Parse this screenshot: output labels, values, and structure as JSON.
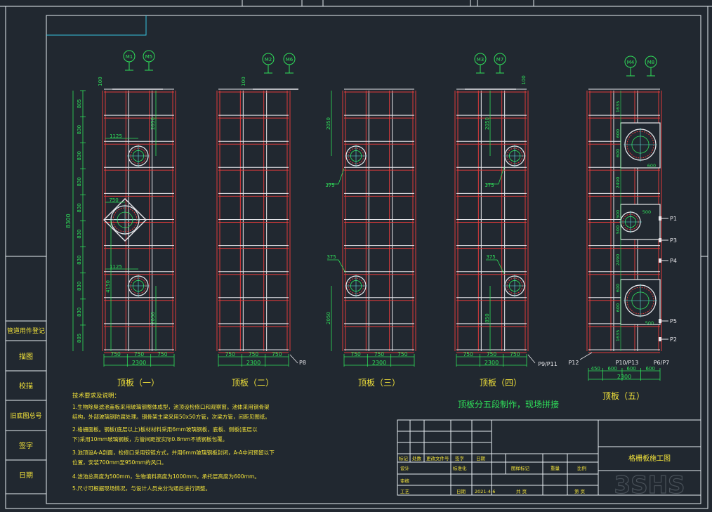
{
  "colors": {
    "background": "#212830",
    "frame": "#e8eef2",
    "border_accent": "#38c5e0",
    "member_red": "#e03a3a",
    "member_white": "#e8e8ec",
    "dimension_green": "#2fe05a",
    "text_yellow": "#f2e23a",
    "marker_cyan": "#5fe6e0"
  },
  "panels": [
    {
      "title": "顶板（一）",
      "tags": [
        "M1",
        "M5"
      ],
      "width_total": "2300",
      "width_parts": [
        "750",
        "750",
        "750"
      ],
      "height_total": "8300",
      "row_dims": [
        "805",
        "830",
        "830",
        "830",
        "830",
        "830",
        "830",
        "830",
        "830",
        "805"
      ],
      "side_dims": [
        "2050",
        "4150",
        "2050"
      ],
      "offsets": [
        "1125",
        "750",
        "1125"
      ],
      "top_dim": "100"
    },
    {
      "title": "顶板（二）",
      "tags": [
        "M2",
        "M6"
      ],
      "width_total": "2300",
      "width_parts": [
        "750",
        "750",
        "750"
      ],
      "top_dim": "100",
      "label": "P8"
    },
    {
      "title": "顶板（三）",
      "tags": [],
      "width_total": "2300",
      "width_parts": [
        "750",
        "750",
        "750"
      ],
      "side_dims": [
        "2050",
        "2050"
      ],
      "leaders": [
        "375",
        "375"
      ]
    },
    {
      "title": "顶板（四）",
      "tags": [
        "M3",
        "M7"
      ],
      "width_total": "2300",
      "width_parts": [
        "750",
        "750",
        "750"
      ],
      "side_dims": [
        "2050",
        "850"
      ],
      "leaders": [
        "375",
        "375"
      ],
      "top_dim": "100",
      "label": "P9/P11"
    },
    {
      "title": "顶板（五）",
      "tags": [
        "M4",
        "M8"
      ],
      "width_total": "2300",
      "width_parts": [
        "450",
        "600",
        "600",
        "600"
      ],
      "side_dims": [
        "1635",
        "600",
        "600",
        "2490",
        "500",
        "500",
        "2490",
        "600",
        "600",
        "1635"
      ],
      "inner_dims": [
        "600",
        "500",
        "500"
      ],
      "ports": [
        "P1",
        "P3",
        "P4",
        "P5",
        "P2"
      ],
      "bottom_labels": [
        "P12",
        "P10/P13",
        "P6/P7"
      ]
    }
  ],
  "segment_note": "顶板分五段制作，现场拼接",
  "notes_title": "技术要求及说明：",
  "notes": [
    "1.生物除臭滤池盖板采用玻璃钢整体成型，池顶设检修口和观察窗。池体采用钢骨架",
    "  结构，外部玻璃钢防腐处理。钢骨架主梁采用50x50方管，次梁方管，间距见图纸。",
    "2.格栅面板。钢板(底层以上)板材材料采用6mm玻璃钢板，底板、侧板(底层以",
    "  下)采用10mm玻璃钢板，方管间距按实际0.8mm不锈钢板包覆。",
    "3.池顶设A-A剖面，检修口采用铰链方式，并用6mm玻璃钢板封闭，A-A中间预留以下",
    "  位置，安装700mm至950mm的风口。",
    "4.滤池总高度为500mm，生物填料高度为1000mm，承托层高度为600mm。",
    "5.尺寸可根据现场情况，与设计人员充分沟通后进行调整。"
  ],
  "left_stamp": [
    "管道用件登记",
    "描图",
    "校描",
    "旧底图总号",
    "签字",
    "日期"
  ],
  "title_block": {
    "drawing_name": "格栅板施工图",
    "rows": [
      [
        "标记",
        "处数",
        "更改文件号",
        "签字",
        "日期"
      ],
      [
        "设计",
        "标准化",
        "图样标记",
        "重量",
        "比例"
      ],
      [
        "审核"
      ],
      [
        "工艺",
        "日期",
        "2021-4-6",
        "共  页",
        "第  页"
      ]
    ]
  },
  "watermark": "3SHS"
}
